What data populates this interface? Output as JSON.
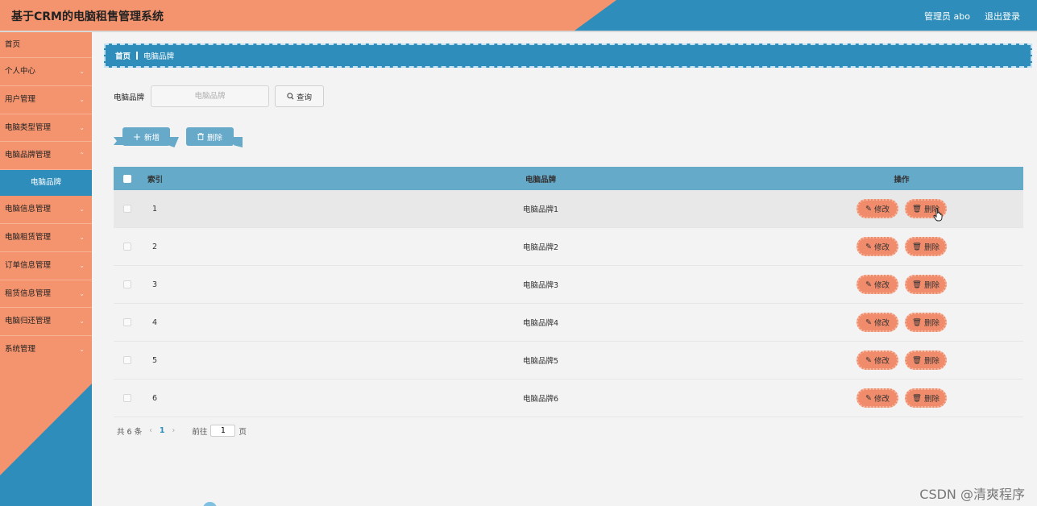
{
  "header": {
    "title": "基于CRM的电脑租售管理系统",
    "user": "管理员 abo",
    "logout": "退出登录"
  },
  "sidebar": {
    "home": "首页",
    "items": [
      {
        "label": "个人中心"
      },
      {
        "label": "用户管理"
      },
      {
        "label": "电脑类型管理"
      },
      {
        "label": "电脑品牌管理"
      }
    ],
    "active_sub": "电脑品牌",
    "items_after": [
      {
        "label": "电脑信息管理"
      },
      {
        "label": "电脑租赁管理"
      },
      {
        "label": "订单信息管理"
      },
      {
        "label": "租赁信息管理"
      },
      {
        "label": "电脑归还管理"
      },
      {
        "label": "系统管理"
      }
    ]
  },
  "breadcrumb": {
    "home": "首页",
    "current": "电脑品牌"
  },
  "search": {
    "label": "电脑品牌",
    "placeholder": "电脑品牌",
    "button": "查询"
  },
  "actions": {
    "add": "新增",
    "delete": "删除"
  },
  "table": {
    "headers": {
      "index": "索引",
      "brand": "电脑品牌",
      "ops": "操作"
    },
    "rows": [
      {
        "index": "1",
        "brand": "电脑品牌1"
      },
      {
        "index": "2",
        "brand": "电脑品牌2"
      },
      {
        "index": "3",
        "brand": "电脑品牌3"
      },
      {
        "index": "4",
        "brand": "电脑品牌4"
      },
      {
        "index": "5",
        "brand": "电脑品牌5"
      },
      {
        "index": "6",
        "brand": "电脑品牌6"
      }
    ],
    "edit_label": "修改",
    "delete_label": "删除"
  },
  "pager": {
    "total": "共 6 条",
    "current": "1",
    "goto_prefix": "前往",
    "goto_value": "1",
    "goto_suffix": "页"
  },
  "watermark": "CSDN @清爽程序",
  "colors": {
    "salmon": "#f4946e",
    "blue": "#2e8dbb",
    "table_header": "#66aaca",
    "op_button": "#f08c6c"
  }
}
